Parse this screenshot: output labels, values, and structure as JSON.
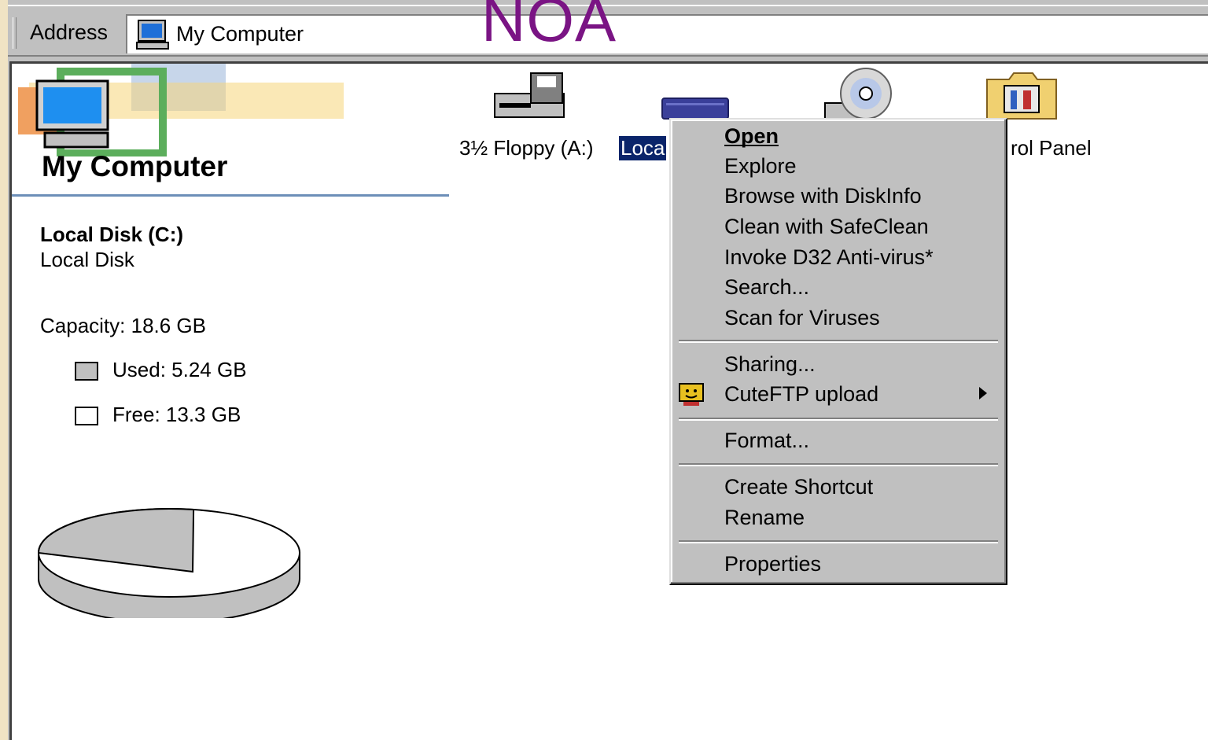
{
  "watermark": "NOA",
  "address_bar": {
    "label": "Address",
    "value": "My Computer",
    "icon": "my-computer-icon"
  },
  "left_panel": {
    "title": "My Computer",
    "disk_name": "Local Disk (C:)",
    "disk_type": "Local Disk",
    "capacity": "Capacity: 18.6 GB",
    "used": "Used: 5.24 GB",
    "free": "Free: 13.3 GB",
    "used_fraction": 0.28,
    "colors": {
      "used": "#c0c0c0",
      "free": "#ffffff",
      "rule": "#6d8fb8"
    }
  },
  "drives": [
    {
      "label": "3½ Floppy (A:)",
      "icon": "floppy-drive-icon"
    },
    {
      "label": "Loca",
      "icon": "hard-disk-icon",
      "selected": true
    },
    {
      "label": "",
      "icon": "cd-drive-icon"
    },
    {
      "label": "rol Panel",
      "icon": "control-panel-icon"
    }
  ],
  "context_menu": {
    "items": [
      {
        "label": "Open",
        "accel": "O"
      },
      {
        "label": "Explore",
        "accel": "x"
      },
      {
        "label": "Browse with DiskInfo"
      },
      {
        "label": "Clean with SafeClean"
      },
      {
        "label": "Invoke D32 Anti-virus*",
        "accel": "I"
      },
      {
        "label": "Search...",
        "accel": "e"
      },
      {
        "label": "Scan for Viruses",
        "accel": "V"
      },
      {
        "label": "Sharing...",
        "accel": "h"
      },
      {
        "label": "CuteFTP upload",
        "icon": "cuteftp-icon",
        "submenu": true
      },
      {
        "label": "Format...",
        "accel": "a"
      },
      {
        "label": "Create Shortcut",
        "accel": "S"
      },
      {
        "label": "Rename",
        "accel": "m"
      },
      {
        "label": "Properties",
        "accel": "r"
      }
    ]
  }
}
